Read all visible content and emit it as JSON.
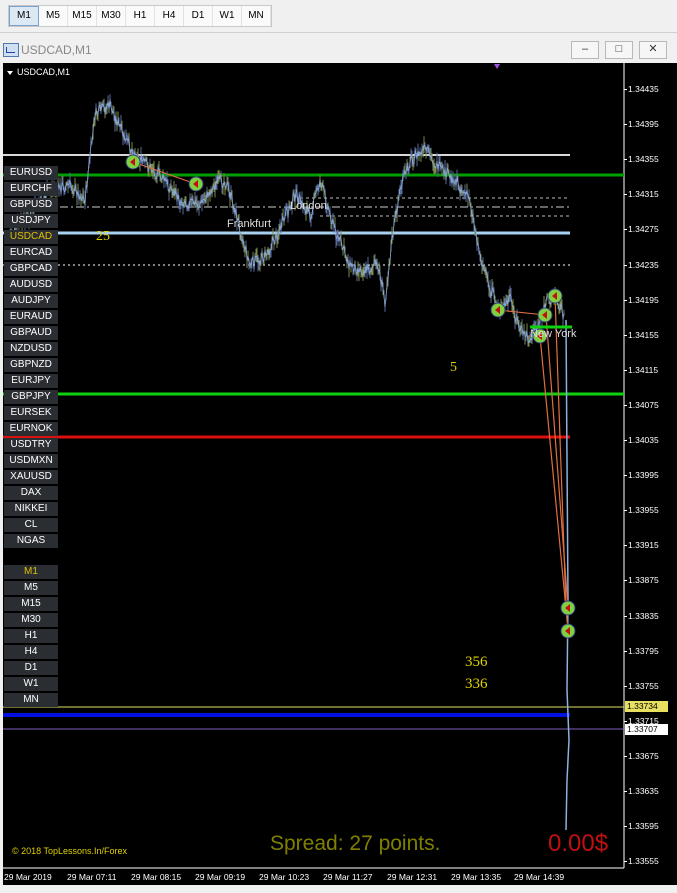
{
  "toolbar": {
    "timeframes": [
      "M1",
      "M5",
      "M15",
      "M30",
      "H1",
      "H4",
      "D1",
      "W1",
      "MN"
    ],
    "active": "M1"
  },
  "window": {
    "title": "USDCAD,M1",
    "minimize": "–",
    "restore": "□",
    "close": "✕"
  },
  "chart": {
    "symbol_label": "USDCAD,M1",
    "symbols": [
      "EURUSD",
      "EURCHF",
      "GBPUSD",
      "USDJPY",
      "USDCAD",
      "EURCAD",
      "GBPCAD",
      "AUDUSD",
      "AUDJPY",
      "EURAUD",
      "GBPAUD",
      "NZDUSD",
      "GBPNZD",
      "EURJPY",
      "GBPJPY",
      "EURSEK",
      "EURNOK",
      "USDTRY",
      "USDMXN",
      "XAUUSD",
      "DAX",
      "NIKKEI",
      "CL",
      "NGAS"
    ],
    "active_symbol": "USDCAD",
    "timeframe_buttons": [
      "M1",
      "M5",
      "M15",
      "M30",
      "H1",
      "H4",
      "D1",
      "W1",
      "MN"
    ],
    "active_timeframe": "M1",
    "sessions": {
      "frankfurt": "Frankfurt",
      "london": "London",
      "newyork": "New York"
    },
    "annotations": {
      "a": "25",
      "b": "5",
      "c": "356",
      "d": "336"
    },
    "copyright": "© 2018 TopLessons.In/Forex",
    "spread": "Spread: 27 points.",
    "profit": "0.00$",
    "colors": {
      "profit": "#c01010",
      "spread": "#808000",
      "annotation": "#e0d000",
      "copyright": "#e0d000"
    }
  },
  "price_axis": {
    "ticks": [
      "1.34435",
      "1.34395",
      "1.34355",
      "1.34315",
      "1.34275",
      "1.34235",
      "1.34195",
      "1.34155",
      "1.34115",
      "1.34075",
      "1.34035",
      "1.33995",
      "1.33955",
      "1.33915",
      "1.33875",
      "1.33835",
      "1.33795",
      "1.33755",
      "1.33715",
      "1.33675",
      "1.33635",
      "1.33595",
      "1.33555"
    ],
    "badge_ask": "1.33734",
    "badge_bid": "1.33707"
  },
  "time_axis": {
    "labels": [
      "29 Mar 2019",
      "29 Mar 07:11",
      "29 Mar 08:15",
      "29 Mar 09:19",
      "29 Mar 10:23",
      "29 Mar 11:27",
      "29 Mar 12:31",
      "29 Mar 13:35",
      "29 Mar 14:39"
    ]
  }
}
